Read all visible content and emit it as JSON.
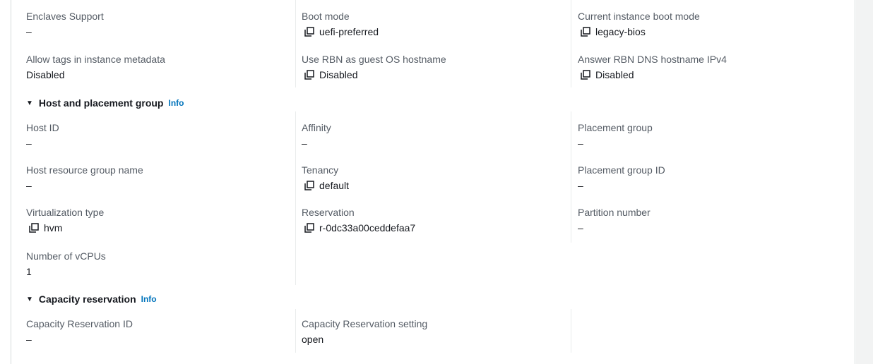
{
  "icons": {
    "copy": "copy-icon",
    "caret": "caret-down-icon"
  },
  "colors": {
    "link": "#0073bb",
    "label": "#545b64",
    "value": "#16191f"
  },
  "dash": "–",
  "row1": {
    "enclaves_support": {
      "label": "Enclaves Support",
      "value": "–"
    },
    "boot_mode": {
      "label": "Boot mode",
      "value": "uefi-preferred"
    },
    "current_boot_mode": {
      "label": "Current instance boot mode",
      "value": "legacy-bios"
    }
  },
  "row2": {
    "allow_tags": {
      "label": "Allow tags in instance metadata",
      "value": "Disabled"
    },
    "use_rbn": {
      "label": "Use RBN as guest OS hostname",
      "value": "Disabled"
    },
    "answer_rbn": {
      "label": "Answer RBN DNS hostname IPv4",
      "value": "Disabled"
    }
  },
  "host_section": {
    "title": "Host and placement group",
    "info": "Info",
    "host_id": {
      "label": "Host ID",
      "value": "–"
    },
    "affinity": {
      "label": "Affinity",
      "value": "–"
    },
    "placement_group": {
      "label": "Placement group",
      "value": "–"
    },
    "host_resource_group": {
      "label": "Host resource group name",
      "value": "–"
    },
    "tenancy": {
      "label": "Tenancy",
      "value": "default"
    },
    "placement_group_id": {
      "label": "Placement group ID",
      "value": "–"
    },
    "virtualization_type": {
      "label": "Virtualization type",
      "value": "hvm"
    },
    "reservation": {
      "label": "Reservation",
      "value": "r-0dc33a00ceddefaa7"
    },
    "partition_number": {
      "label": "Partition number",
      "value": "–"
    },
    "vcpus": {
      "label": "Number of vCPUs",
      "value": "1"
    }
  },
  "capacity_section": {
    "title": "Capacity reservation",
    "info": "Info",
    "reservation_id": {
      "label": "Capacity Reservation ID",
      "value": "–"
    },
    "reservation_setting": {
      "label": "Capacity Reservation setting",
      "value": "open"
    }
  }
}
